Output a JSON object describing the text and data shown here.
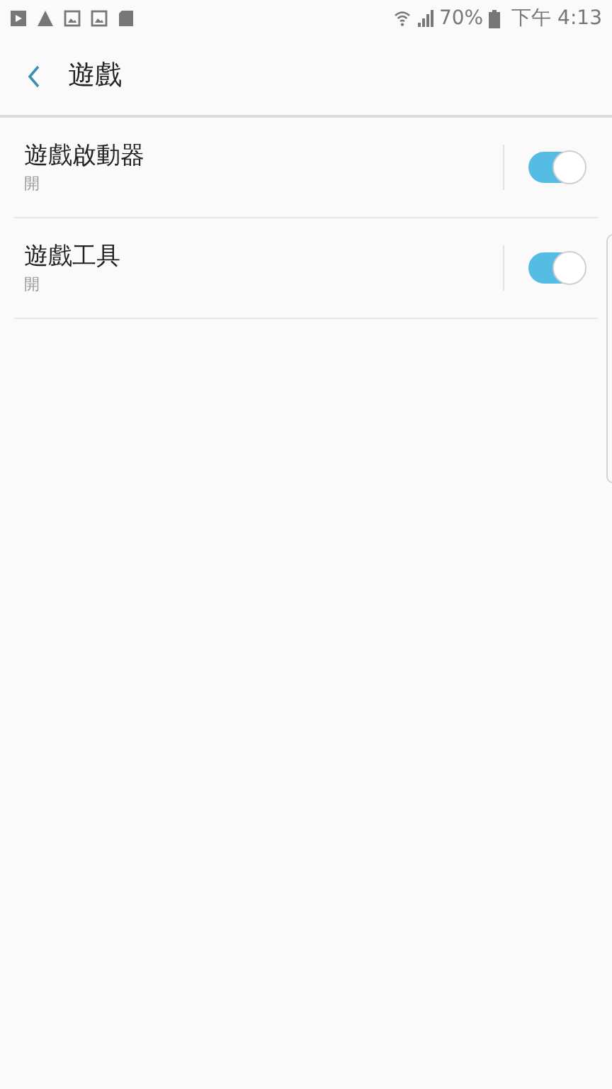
{
  "status_bar": {
    "battery": "70%",
    "time": "下午 4:13"
  },
  "header": {
    "title": "遊戲"
  },
  "settings": [
    {
      "title": "遊戲啟動器",
      "status": "開",
      "on": true
    },
    {
      "title": "遊戲工具",
      "status": "開",
      "on": true
    }
  ]
}
